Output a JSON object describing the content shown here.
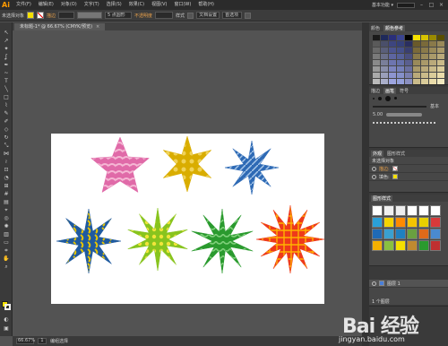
{
  "app": {
    "logo": "Ai"
  },
  "menu": {
    "items": [
      "文件(F)",
      "编辑(E)",
      "对象(O)",
      "文字(T)",
      "选择(S)",
      "效果(C)",
      "视图(V)",
      "窗口(W)",
      "帮助(H)"
    ],
    "workspace": "基本功能 ▾",
    "win_buttons": [
      "–",
      "□",
      "×"
    ]
  },
  "control_bar": {
    "selection_label": "未选择对象",
    "fill_color": "#f5e000",
    "stroke_label": "描边",
    "brush_size": "5 点圆形",
    "opacity_label": "不透明度",
    "style_label": "样式",
    "doc_setup": "文档设置",
    "prefs": "首选项"
  },
  "document": {
    "tab_title": "未标题-1* @ 66.67% (CMYK/预览)",
    "close": "×"
  },
  "status": {
    "zoom": "66.67%",
    "page": "1",
    "tool_name": "编组选择"
  },
  "panels": {
    "swatches_tabs": [
      "颜色",
      "颜色参考"
    ],
    "color_label": "颜色",
    "brush_tabs": [
      "描边",
      "画笔",
      "符号"
    ],
    "brush_size": "5.00",
    "basic_label": "基本",
    "appearance_tabs": [
      "外观",
      "图形样式"
    ],
    "appearance_title": "未选择对象",
    "appearance_rows": [
      "描边:",
      "填色:"
    ],
    "styles_title": "图形样式",
    "layers_label": "图层 1",
    "layer_count": "1 个图层"
  },
  "watermark": {
    "main": "Bai 经验",
    "sub": "jingyan.baidu.com"
  },
  "stars": [
    {
      "name": "pink-swirl-star",
      "color": "#e06aa8",
      "accent": "#f5b7d4"
    },
    {
      "name": "yellow-star",
      "color": "#d9ad00",
      "accent": "#f0d35a"
    },
    {
      "name": "blue-spiky-star",
      "color": "#2e6ab5",
      "accent": "#a9c8ea"
    },
    {
      "name": "blue-yellow-star",
      "color": "#1f5aa0",
      "accent": "#e8c500"
    },
    {
      "name": "lime-star",
      "color": "#88c41e",
      "accent": "#f2e53a"
    },
    {
      "name": "green-star",
      "color": "#2a9a2e",
      "accent": "#7fd07a"
    },
    {
      "name": "orange-red-star",
      "color": "#ee3a1a",
      "accent": "#ffb300"
    }
  ]
}
